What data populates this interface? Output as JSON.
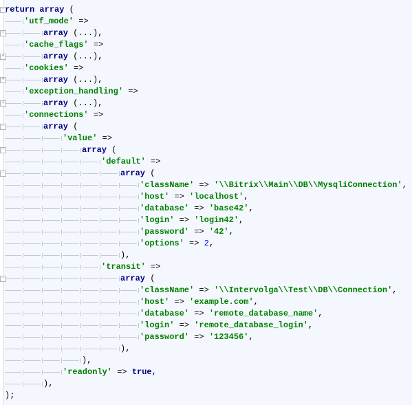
{
  "editor": {
    "language": "php",
    "colors": {
      "keyword": "#000080",
      "string": "#008000",
      "number": "#0000ff",
      "background": "#f4f7fd"
    },
    "lines": [
      {
        "indent": 0,
        "text": "return array (",
        "fold": "open"
      },
      {
        "indent": 1,
        "text": "'utf_mode' =>"
      },
      {
        "indent": 2,
        "text": "array (...),",
        "fold": "collapsed"
      },
      {
        "indent": 1,
        "text": "'cache_flags' =>"
      },
      {
        "indent": 2,
        "text": "array (...),",
        "fold": "collapsed"
      },
      {
        "indent": 1,
        "text": "'cookies' =>"
      },
      {
        "indent": 2,
        "text": "array (...),",
        "fold": "collapsed"
      },
      {
        "indent": 1,
        "text": "'exception_handling' =>"
      },
      {
        "indent": 2,
        "text": "array (...),",
        "fold": "collapsed"
      },
      {
        "indent": 1,
        "text": "'connections' =>"
      },
      {
        "indent": 2,
        "text": "array (",
        "fold": "open"
      },
      {
        "indent": 3,
        "text": "'value' =>"
      },
      {
        "indent": 4,
        "text": "array (",
        "fold": "open"
      },
      {
        "indent": 5,
        "text": "'default' =>"
      },
      {
        "indent": 6,
        "text": "array (",
        "fold": "open"
      },
      {
        "indent": 7,
        "text": "'className' => '\\\\Bitrix\\\\Main\\\\DB\\\\MysqliConnection',"
      },
      {
        "indent": 7,
        "text": "'host' => 'localhost',"
      },
      {
        "indent": 7,
        "text": "'database' => 'base42',"
      },
      {
        "indent": 7,
        "text": "'login' => 'login42',"
      },
      {
        "indent": 7,
        "text": "'password' => '42',"
      },
      {
        "indent": 7,
        "text": "'options' => 2,"
      },
      {
        "indent": 6,
        "text": "),"
      },
      {
        "indent": 5,
        "text": "'transit' =>"
      },
      {
        "indent": 6,
        "text": "array (",
        "fold": "open"
      },
      {
        "indent": 7,
        "text": "'className' => '\\\\Intervolga\\\\Test\\\\DB\\\\Connection',"
      },
      {
        "indent": 7,
        "text": "'host' => 'example.com',"
      },
      {
        "indent": 7,
        "text": "'database' => 'remote_database_name',"
      },
      {
        "indent": 7,
        "text": "'login' => 'remote_database_login',"
      },
      {
        "indent": 7,
        "text": "'password' => '123456',"
      },
      {
        "indent": 6,
        "text": "),"
      },
      {
        "indent": 4,
        "text": "),"
      },
      {
        "indent": 3,
        "text": "'readonly' => true,"
      },
      {
        "indent": 2,
        "text": "),"
      },
      {
        "indent": 0,
        "text": ");"
      }
    ]
  }
}
